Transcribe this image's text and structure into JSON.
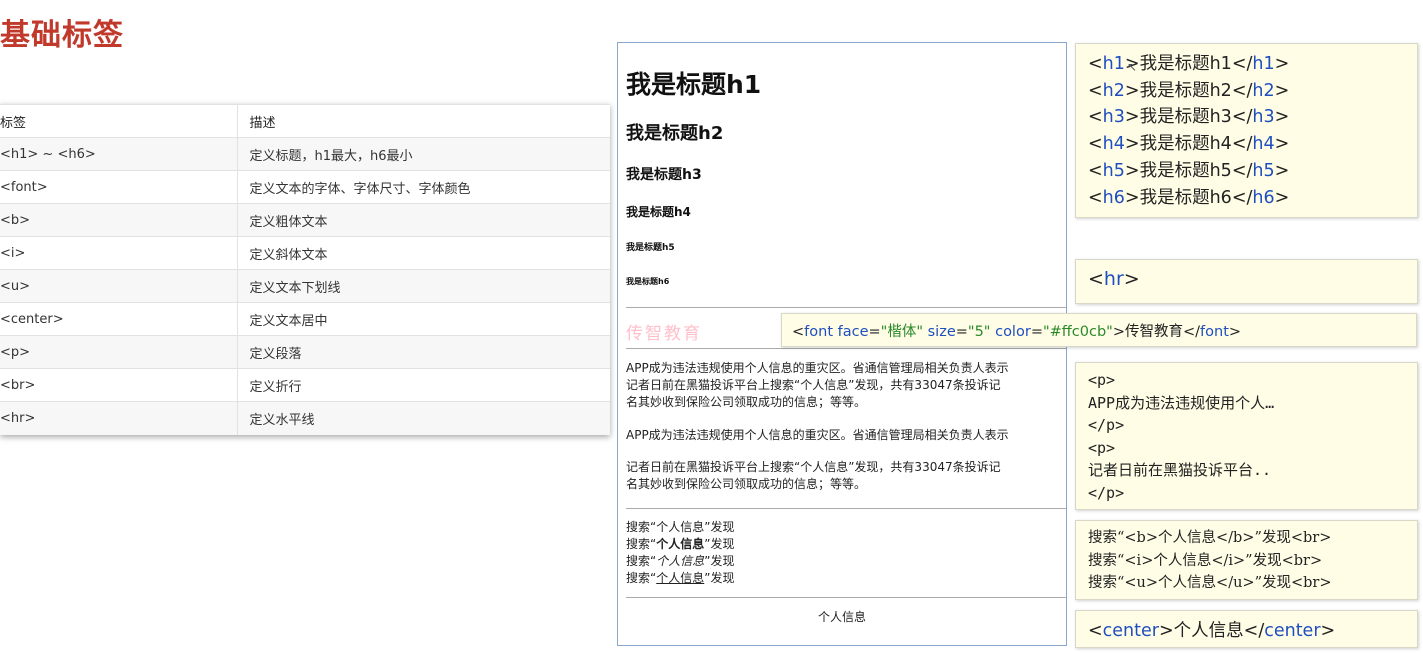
{
  "page_title": "基础标签",
  "table": {
    "headers": [
      "标签",
      "描述"
    ],
    "rows": [
      [
        "<h1> ~ <h6>",
        "定义标题，h1最大，h6最小"
      ],
      [
        "<font>",
        "定义文本的字体、字体尺寸、字体颜色"
      ],
      [
        "<b>",
        "定义粗体文本"
      ],
      [
        "<i>",
        "定义斜体文本"
      ],
      [
        "<u>",
        "定义文本下划线"
      ],
      [
        "<center>",
        "定义文本居中"
      ],
      [
        "<p>",
        "定义段落"
      ],
      [
        "<br>",
        "定义折行"
      ],
      [
        "<hr>",
        "定义水平线"
      ]
    ]
  },
  "demo": {
    "h1": "我是标题h1",
    "h2": "我是标题h2",
    "h3": "我是标题h3",
    "h4": "我是标题h4",
    "h5": "我是标题h5",
    "h6": "我是标题h6",
    "font_text": "传智教育",
    "font_color": "#ffc0cb",
    "p1_line1": "APP成为违法违规使用个人信息的重灾区。省通信管理局相关负责人表示",
    "p1_line2": "记者日前在黑猫投诉平台上搜索“个人信息”发现，共有33047条投诉记",
    "p1_line3": "名其妙收到保险公司领取成功的信息；等等。",
    "p2": "APP成为违法违规使用个人信息的重灾区。省通信管理局相关负责人表示",
    "p3_line1": "记者日前在黑猫投诉平台上搜索“个人信息”发现，共有33047条投诉记",
    "p3_line2": "名其妙收到保险公司领取成功的信息；等等。",
    "search_prefix": "搜索“",
    "search_keyword": "个人信息",
    "search_suffix": "”发现",
    "center_text": "个人信息"
  },
  "code": {
    "h_lines": [
      {
        "open": "h1",
        "text": "我是标题h1",
        "close": "h1"
      },
      {
        "open": "h2",
        "text": "我是标题h2",
        "close": "h2"
      },
      {
        "open": "h3",
        "text": "我是标题h3",
        "close": "h3"
      },
      {
        "open": "h4",
        "text": "我是标题h4",
        "close": "h4"
      },
      {
        "open": "h5",
        "text": "我是标题h5",
        "close": "h5"
      },
      {
        "open": "h6",
        "text": "我是标题h6",
        "close": "h6"
      }
    ],
    "hr": "hr",
    "font": {
      "tag": "font",
      "attr_face": "face",
      "val_face": "\"楷体\"",
      "attr_size": "size",
      "val_size": "\"5\"",
      "attr_color": "color",
      "val_color": "\"#ffc0cb\"",
      "text": "传智教育"
    },
    "p_lines": [
      "<p>",
      "APP成为违法违规使用个人…",
      "</p>",
      "<p>",
      "记者日前在黑猫投诉平台..",
      "</p>"
    ],
    "biu_lines": [
      "搜索“<b>个人信息</b>”发现<br>",
      "搜索“<i>个人信息</i>”发现<br>",
      "搜索“<u>个人信息</u>”发现<br>"
    ],
    "center": {
      "tag": "center",
      "text": "个人信息"
    }
  }
}
